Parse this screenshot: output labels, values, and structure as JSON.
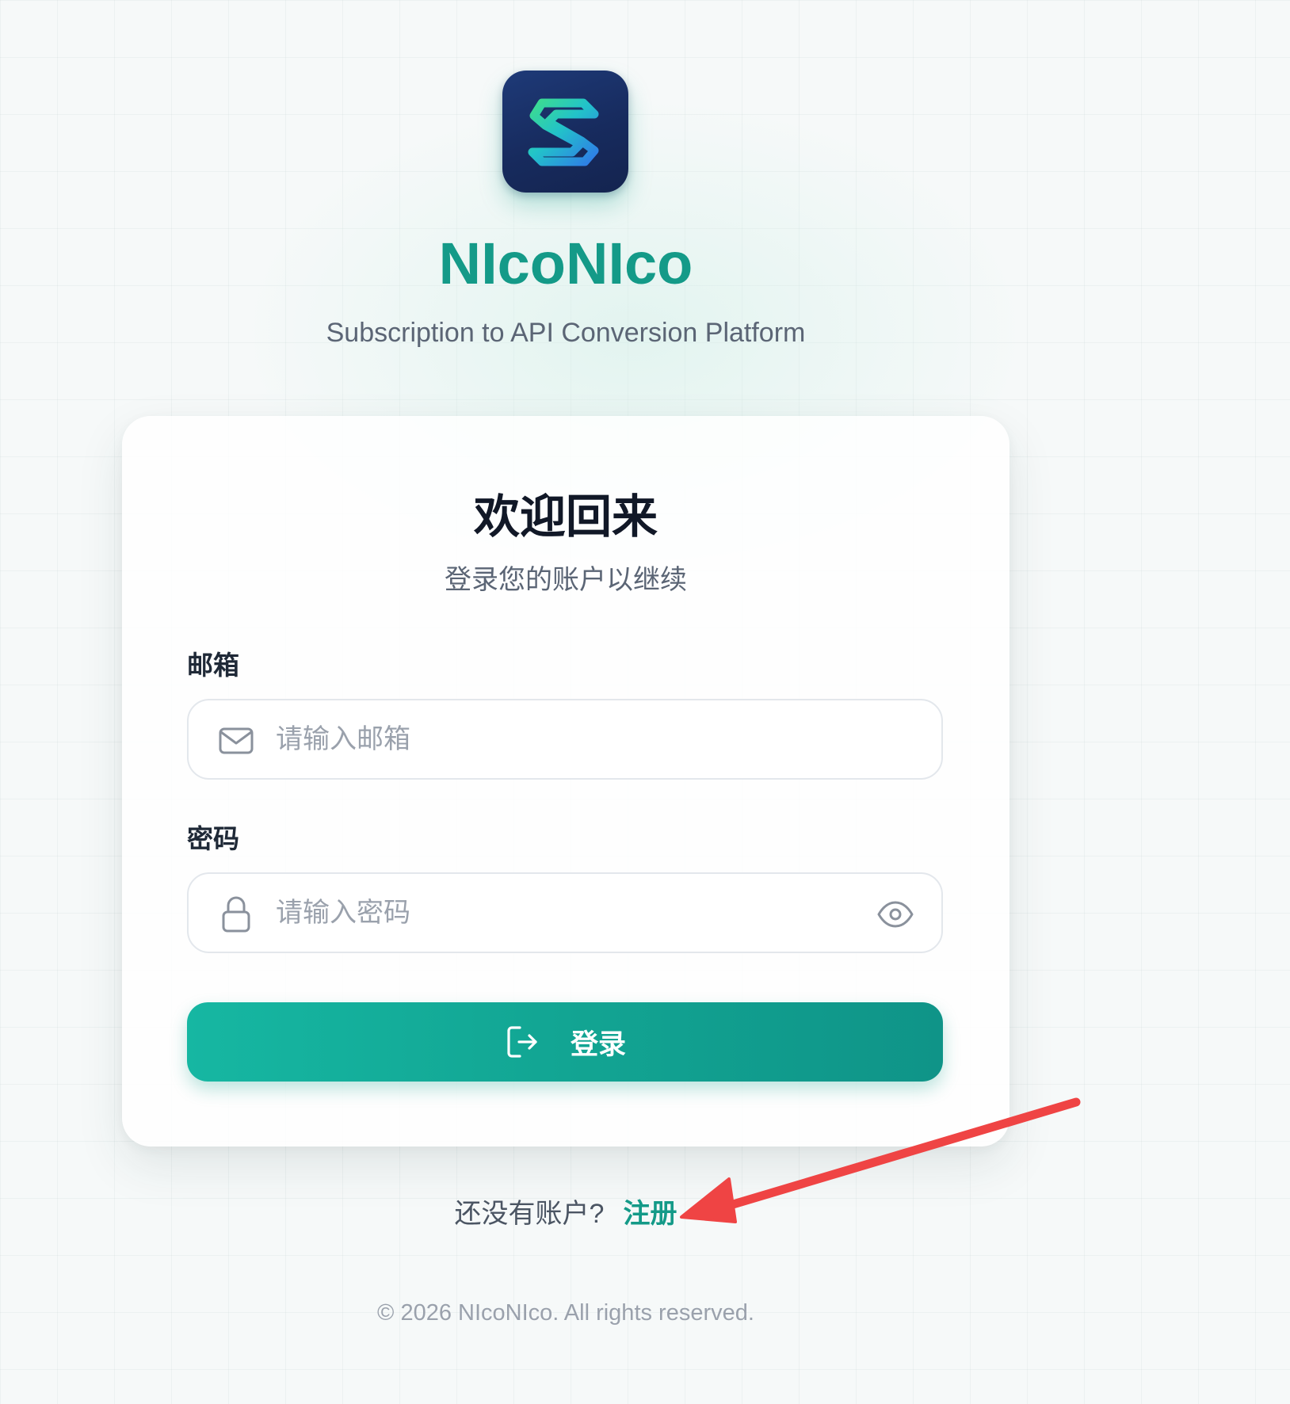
{
  "brand": {
    "logo_icon": "s-shape-logo-icon",
    "name": "NIcoNIco",
    "subtitle": "Subscription to API Conversion Platform"
  },
  "login_card": {
    "title": "欢迎回来",
    "subtitle": "登录您的账户以继续",
    "email": {
      "label": "邮箱",
      "placeholder": "请输入邮箱",
      "value": "",
      "icon": "mail-icon"
    },
    "password": {
      "label": "密码",
      "placeholder": "请输入密码",
      "value": "",
      "icon": "lock-icon",
      "toggle_icon": "eye-icon"
    },
    "submit": {
      "label": "登录",
      "icon": "login-icon"
    }
  },
  "register": {
    "prompt": "还没有账户?",
    "link_label": "注册"
  },
  "footer": {
    "copyright": "© 2026 NIcoNIco. All rights reserved."
  },
  "annotation": {
    "arrow_color": "#ef4444"
  },
  "colors": {
    "accent": "#149a88",
    "button_gradient_start": "#16b7a2",
    "button_gradient_end": "#0f9488",
    "logo_background": "#1b3166"
  }
}
